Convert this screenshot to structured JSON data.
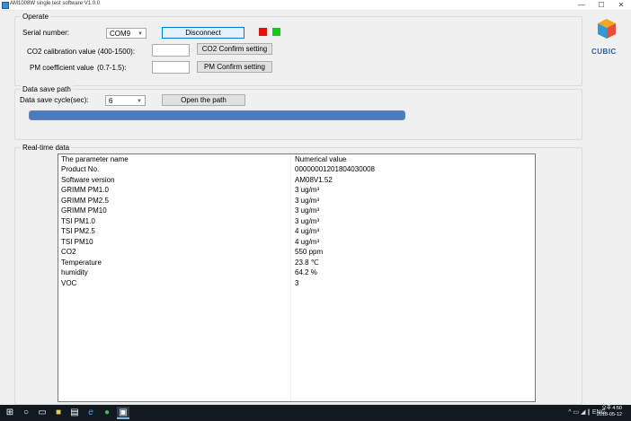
{
  "window": {
    "title": "AM1008W single test software V1.0.0",
    "controls": {
      "minimize": "—",
      "maximize": "☐",
      "close": "✕"
    }
  },
  "operate": {
    "group_title": "Operate",
    "serial_label": "Serial number:",
    "serial_value": "COM9",
    "disconnect_label": "Disconnect",
    "led_colors": [
      "#e01010",
      "#19c919"
    ],
    "co2_label": "CO2 calibration value (400-1500):",
    "co2_value": "",
    "co2_button": "CO2 Confirm setting",
    "pm_label": "PM coefficient value",
    "pm_range": "(0.7-1.5):",
    "pm_value": "",
    "pm_button": "PM  Confirm setting"
  },
  "logo": {
    "text": "CUBIC",
    "colors": {
      "top": "#f5a623",
      "left": "#2e9bd6",
      "right": "#e94e3a"
    }
  },
  "data_save": {
    "group_title": "Data save path",
    "cycle_label": "Data save cycle(sec):",
    "cycle_value": "6",
    "open_path_button": "Open the path",
    "progress_fraction": 1.0
  },
  "realtime": {
    "group_title": "Real-time data",
    "headers": [
      "The parameter name",
      "Numerical value"
    ],
    "rows": [
      [
        "Product No.",
        "00000001201804030008"
      ],
      [
        "Software version",
        "AM08V1.52"
      ],
      [
        "GRIMM PM1.0",
        "3 ug/m³"
      ],
      [
        "GRIMM PM2.5",
        "3 ug/m³"
      ],
      [
        "GRIMM PM10",
        "3 ug/m³"
      ],
      [
        "TSI PM1.0",
        "3 ug/m³"
      ],
      [
        "TSI PM2.5",
        "4 ug/m³"
      ],
      [
        "TSI PM10",
        "4 ug/m³"
      ],
      [
        "CO2",
        "550 ppm"
      ],
      [
        "Temperature",
        "23.8 ℃"
      ],
      [
        "humidity",
        "64.2 %"
      ],
      [
        "VOC",
        "3"
      ]
    ]
  },
  "taskbar": {
    "tray": "^ ▭ ◢ ∥ ENG",
    "time": "오후 4:50",
    "date": "2018-05-12"
  }
}
